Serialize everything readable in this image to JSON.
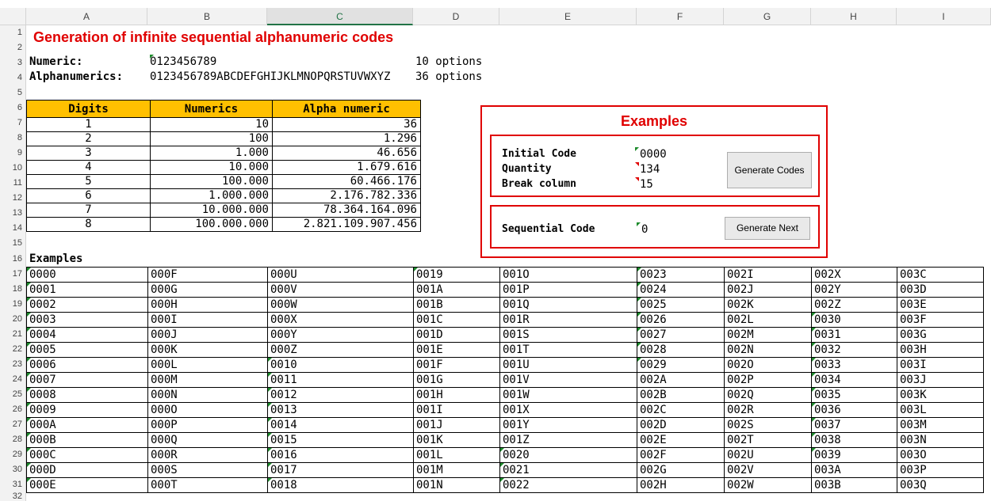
{
  "columns": [
    "A",
    "B",
    "C",
    "D",
    "E",
    "F",
    "G",
    "H",
    "I"
  ],
  "rows": [
    "1",
    "2",
    "3",
    "4",
    "5",
    "6",
    "7",
    "8",
    "9",
    "10",
    "11",
    "12",
    "13",
    "14",
    "15",
    "16",
    "17",
    "18",
    "19",
    "20",
    "21",
    "22",
    "23",
    "24",
    "25",
    "26",
    "27",
    "28",
    "29",
    "30",
    "31",
    "32"
  ],
  "title": "Generation of infinite sequential alphanumeric codes",
  "numeric": {
    "label": "Numeric:",
    "value": "0123456789",
    "options": "10 options"
  },
  "alpha": {
    "label": "Alphanumerics:",
    "value": "0123456789ABCDEFGHIJKLMNOPQRSTUVWXYZ",
    "options": "36 options"
  },
  "table": {
    "headers": [
      "Digits",
      "Numerics",
      "Alpha numeric"
    ],
    "rows": [
      [
        "1",
        "10",
        "36"
      ],
      [
        "2",
        "100",
        "1.296"
      ],
      [
        "3",
        "1.000",
        "46.656"
      ],
      [
        "4",
        "10.000",
        "1.679.616"
      ],
      [
        "5",
        "100.000",
        "60.466.176"
      ],
      [
        "6",
        "1.000.000",
        "2.176.782.336"
      ],
      [
        "7",
        "10.000.000",
        "78.364.164.096"
      ],
      [
        "8",
        "100.000.000",
        "2.821.109.907.456"
      ]
    ]
  },
  "examples_panel": {
    "title": "Examples",
    "initial_code_label": "Initial Code",
    "initial_code_value": "0000",
    "quantity_label": "Quantity",
    "quantity_value": "134",
    "break_label": "Break column",
    "break_value": "15",
    "generate_codes_button": "Generate Codes",
    "sequential_label": "Sequential Code",
    "sequential_value": "0",
    "generate_next_button": "Generate Next"
  },
  "examples_label": "Examples",
  "examples": [
    [
      "0000",
      "000F",
      "000U",
      "0019",
      "001O",
      "0023",
      "002I",
      "002X",
      "003C"
    ],
    [
      "0001",
      "000G",
      "000V",
      "001A",
      "001P",
      "0024",
      "002J",
      "002Y",
      "003D"
    ],
    [
      "0002",
      "000H",
      "000W",
      "001B",
      "001Q",
      "0025",
      "002K",
      "002Z",
      "003E"
    ],
    [
      "0003",
      "000I",
      "000X",
      "001C",
      "001R",
      "0026",
      "002L",
      "0030",
      "003F"
    ],
    [
      "0004",
      "000J",
      "000Y",
      "001D",
      "001S",
      "0027",
      "002M",
      "0031",
      "003G"
    ],
    [
      "0005",
      "000K",
      "000Z",
      "001E",
      "001T",
      "0028",
      "002N",
      "0032",
      "003H"
    ],
    [
      "0006",
      "000L",
      "0010",
      "001F",
      "001U",
      "0029",
      "002O",
      "0033",
      "003I"
    ],
    [
      "0007",
      "000M",
      "0011",
      "001G",
      "001V",
      "002A",
      "002P",
      "0034",
      "003J"
    ],
    [
      "0008",
      "000N",
      "0012",
      "001H",
      "001W",
      "002B",
      "002Q",
      "0035",
      "003K"
    ],
    [
      "0009",
      "000O",
      "0013",
      "001I",
      "001X",
      "002C",
      "002R",
      "0036",
      "003L"
    ],
    [
      "000A",
      "000P",
      "0014",
      "001J",
      "001Y",
      "002D",
      "002S",
      "0037",
      "003M"
    ],
    [
      "000B",
      "000Q",
      "0015",
      "001K",
      "001Z",
      "002E",
      "002T",
      "0038",
      "003N"
    ],
    [
      "000C",
      "000R",
      "0016",
      "001L",
      "0020",
      "002F",
      "002U",
      "0039",
      "003O"
    ],
    [
      "000D",
      "000S",
      "0017",
      "001M",
      "0021",
      "002G",
      "002V",
      "003A",
      "003P"
    ],
    [
      "000E",
      "000T",
      "0018",
      "001N",
      "0022",
      "002H",
      "002W",
      "003B",
      "003Q"
    ]
  ],
  "green_marks": [
    "0000",
    "0001",
    "0002",
    "0003",
    "0004",
    "0005",
    "0006",
    "0007",
    "0008",
    "0009",
    "000A",
    "000B",
    "000C",
    "000D",
    "000E",
    "0010",
    "0011",
    "0012",
    "0013",
    "0014",
    "0015",
    "0016",
    "0017",
    "0018",
    "0019",
    "0020",
    "0021",
    "0022",
    "0023",
    "0024",
    "0025",
    "0026",
    "0027",
    "0028",
    "0029",
    "0030",
    "0031",
    "0032",
    "0033",
    "0034",
    "0035",
    "0036",
    "0037",
    "0038",
    "0039"
  ],
  "colors": {
    "accent_red": "#e00000",
    "header_fill": "#ffc000",
    "excel_green": "#217346"
  }
}
